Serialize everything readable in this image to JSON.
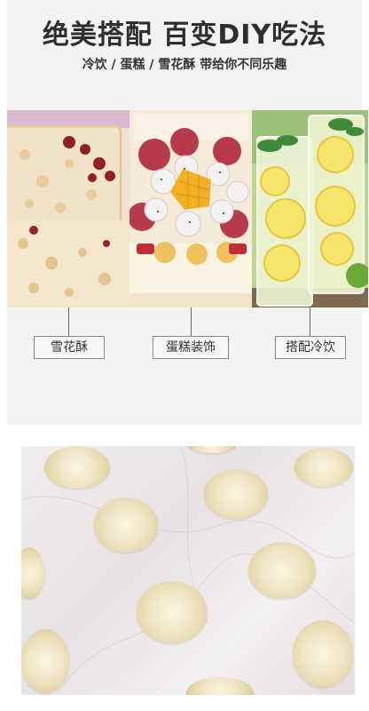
{
  "header": {
    "title": "绝美搭配 百变DIY吃法",
    "subtitle": "冷饮 / 蛋糕 / 雪花酥 带给你不同乐趣"
  },
  "usages": [
    {
      "label": "雪花酥"
    },
    {
      "label": "蛋糕装饰"
    },
    {
      "label": "搭配冷饮"
    }
  ],
  "colors": {
    "text": "#2e2e2e",
    "panel": "#f3f3f3"
  }
}
